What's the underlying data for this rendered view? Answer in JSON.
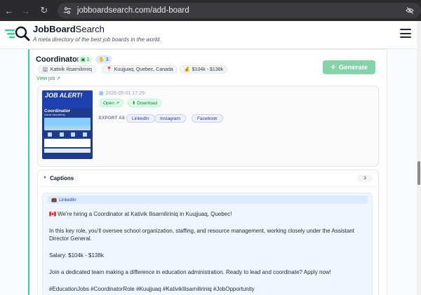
{
  "browser": {
    "url": "jobboardsearch.com/add-board",
    "icons": [
      "back-arrow-icon",
      "forward-arrow-icon",
      "reload-icon",
      "site-settings-icon",
      "eye-off-icon"
    ]
  },
  "site": {
    "brand_bold": "JobBoard",
    "brand_light": "Search",
    "tagline": "A meta directory of the best job boards in the world."
  },
  "job": {
    "title": "Coordinator",
    "badge_green": "1",
    "badge_blue": "3",
    "organization": "Kativik Ilisarniliriniq",
    "location": "Kuujjuaq, Quebec, Canada",
    "salary": "$104k - $138k",
    "view_job": "View job ↗",
    "generate_label": "Generate"
  },
  "post": {
    "date": "2026-05-01 17:29",
    "open_label": "Open ↗",
    "download_label": "⬇ Download",
    "export_label": "EXPORT AS",
    "exports": [
      "LinkedIn",
      "Instagram",
      "Facebook"
    ],
    "poster": {
      "headline": "JOB ALERT!",
      "role": "Coordinator",
      "org": "Kativik Ilisarniliriniq"
    }
  },
  "captions": {
    "title": "Captions",
    "count": "3",
    "platform": "LinkedIn",
    "lines": [
      "🇨🇦 We're hiring a Coordinator at Kativik Ilisarniliriniq in Kuujjuaq, Quebec!",
      "In this key role, you'll oversee school organization, staffing, and resource management, working closely under the Assistant",
      "Director General.",
      "Salary: $104k - $138k",
      "Join a dedicated team making a difference in education administration. Ready to lead and coordinate? Apply now!",
      "#EducationJobs #CoordinatorRole #Kuujjuaq #KativikIlisarniliriniq #JobOpportunity"
    ]
  },
  "colors": {
    "accent_green": "#34d399",
    "generate_button": "#86d3ab",
    "chrome_dark": "#2b2b2e"
  }
}
